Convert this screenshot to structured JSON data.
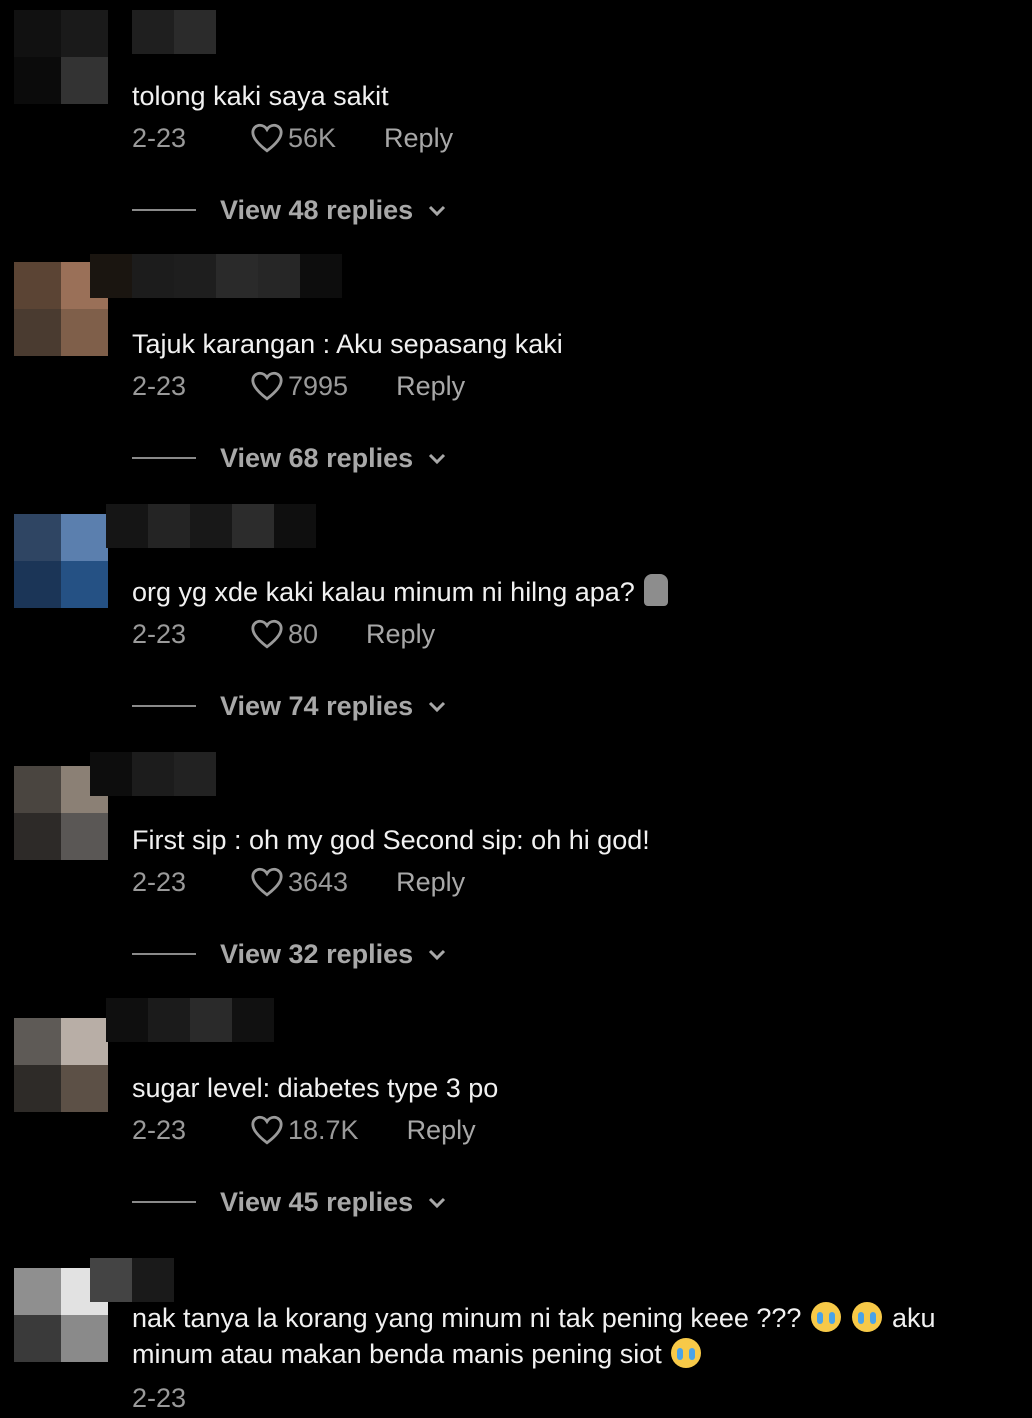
{
  "comments": [
    {
      "text": "tolong kaki saya sakit",
      "date": "2-23",
      "likes": "56K",
      "reply": "Reply",
      "view_replies": "View 48 replies",
      "avatar_colors": [
        "#111111",
        "#1a1a1a",
        "#0b0b0b",
        "#333333"
      ]
    },
    {
      "text": "Tajuk karangan : Aku sepasang kaki",
      "date": "2-23",
      "likes": "7995",
      "reply": "Reply",
      "view_replies": "View 68 replies",
      "avatar_colors": [
        "#5b4434",
        "#9a7058",
        "#4a3b30",
        "#7f5f4a"
      ]
    },
    {
      "text": "org yg xde kaki kalau minum ni hilng apa?",
      "date": "2-23",
      "likes": "80",
      "reply": "Reply",
      "view_replies": "View 74 replies",
      "emoji_end": "moai-icon",
      "avatar_colors": [
        "#2f4563",
        "#5b7fae",
        "#1b3557",
        "#255184"
      ]
    },
    {
      "text": "First sip : oh my god Second sip: oh hi god!",
      "date": "2-23",
      "likes": "3643",
      "reply": "Reply",
      "view_replies": "View 32 replies",
      "avatar_colors": [
        "#4a4540",
        "#8b8075",
        "#2d2a28",
        "#5a5755"
      ]
    },
    {
      "text": "sugar level: diabetes type 3 po",
      "date": "2-23",
      "likes": "18.7K",
      "reply": "Reply",
      "view_replies": "View 45 replies",
      "avatar_colors": [
        "#5e5a56",
        "#b8aea6",
        "#2e2b28",
        "#5c5046"
      ]
    },
    {
      "text_part1": "nak tanya la korang yang minum ni tak pening keee ???",
      "text_part2": "aku",
      "text_part3": "minum atau makan benda manis pening siot",
      "date": "2-23",
      "avatar_colors": [
        "#8f8f8f",
        "#e2e2e2",
        "#3a3a3a",
        "#8a8a8a"
      ]
    }
  ]
}
